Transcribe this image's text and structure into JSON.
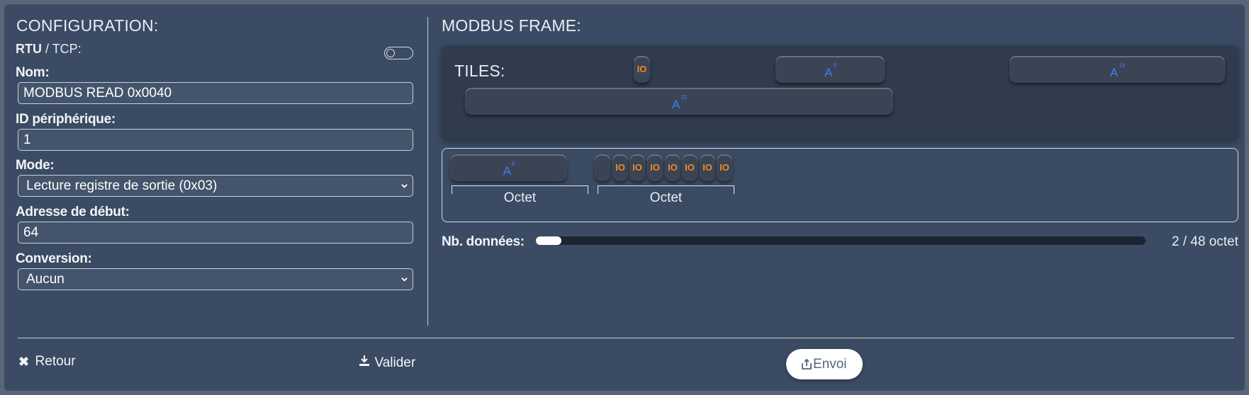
{
  "config": {
    "title": "CONFIGURATION:",
    "protocol_rtu": "RTU",
    "protocol_sep": " / ",
    "protocol_tcp": "TCP:",
    "nom_label": "Nom:",
    "nom_value": "MODBUS READ 0x0040",
    "device_id_label": "ID périphérique:",
    "device_id_value": "1",
    "mode_label": "Mode:",
    "mode_value": "Lecture registre de sortie (0x03)",
    "start_address_label": "Adresse de début:",
    "start_address_value": "64",
    "conversion_label": "Conversion:",
    "conversion_value": "Aucun"
  },
  "frame": {
    "title": "MODBUS FRAME:",
    "tiles_label": "TILES:",
    "tiles": [
      {
        "text": "IO",
        "kind": "io"
      },
      {
        "text": "A",
        "sup": "8",
        "kind": "analog"
      },
      {
        "text": "A",
        "sup": "16",
        "kind": "analog"
      },
      {
        "text": "A",
        "sup": "32",
        "kind": "analog"
      }
    ],
    "frame_analog": {
      "text": "A",
      "sup": "8"
    },
    "frame_io_label": "IO",
    "octet_label": "Octet",
    "data_count_label": "Nb. données:",
    "data_count_value": "2 / 48 octet",
    "data_progress": 0.042
  },
  "actions": {
    "back": "Retour",
    "validate": "Valider",
    "send": "Envoi"
  },
  "colors": {
    "panel": "#3a4b63",
    "io": "#f0892c",
    "analog": "#3f7cf5"
  }
}
